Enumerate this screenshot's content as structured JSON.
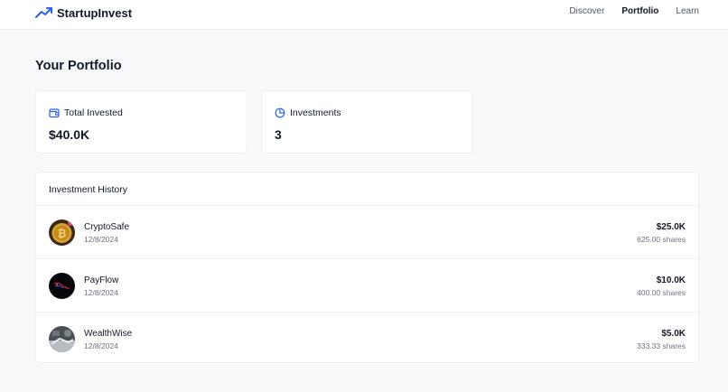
{
  "app": {
    "name": "StartupInvest",
    "logo_icon": "trending-up-icon",
    "accent": "#2563eb"
  },
  "nav": {
    "items": [
      {
        "label": "Discover",
        "active": false
      },
      {
        "label": "Portfolio",
        "active": true
      },
      {
        "label": "Learn",
        "active": false
      }
    ]
  },
  "page": {
    "title": "Your Portfolio"
  },
  "stats": [
    {
      "icon": "wallet-icon",
      "label": "Total Invested",
      "value": "$40.0K"
    },
    {
      "icon": "pie-chart-icon",
      "label": "Investments",
      "value": "3"
    }
  ],
  "history": {
    "title": "Investment History",
    "rows": [
      {
        "name": "CryptoSafe",
        "date": "12/8/2024",
        "amount": "$25.0K",
        "shares": "625.00 shares",
        "logo": "bitcoin-coin-image"
      },
      {
        "name": "PayFlow",
        "date": "12/8/2024",
        "amount": "$10.0K",
        "shares": "400.00 shares",
        "logo": "dark-abstract-image"
      },
      {
        "name": "WealthWise",
        "date": "12/8/2024",
        "amount": "$5.0K",
        "shares": "333.33 shares",
        "logo": "finance-photo-image"
      }
    ]
  }
}
